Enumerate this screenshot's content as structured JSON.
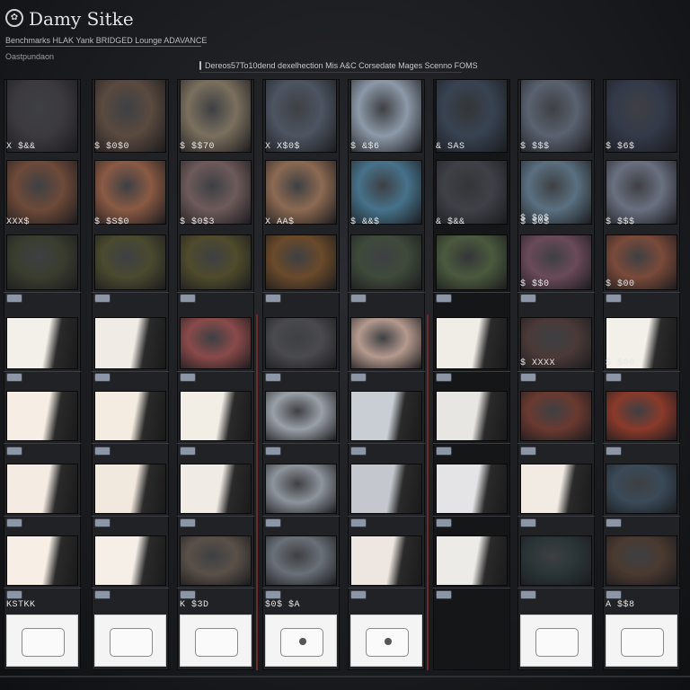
{
  "header": {
    "logo_mark": "✿",
    "brand": "Damy Sitke",
    "subline1": "Benchmarks HLAK Yank BRIDGED Lounge ADAVANCE",
    "subline2": "Oastpundaon",
    "search_text": "Dereos57To10dend dexelhection Mis A&C Corsedate Mages Scenno FOMS"
  },
  "columns": [
    {
      "prices": [
        "X $&&",
        "XXX$",
        "",
        "",
        "",
        "",
        "",
        "KSTKK"
      ],
      "tiles": [
        "#3c3a3f",
        "#6e4a39",
        "#3a3d2e",
        "#f3efe9",
        "#f6eee4",
        "#f4ebe3",
        "#f7efe6"
      ],
      "product": true
    },
    {
      "prices": [
        "$ $0$0",
        "$ $S$0",
        "",
        "",
        "",
        "",
        "",
        ""
      ],
      "tiles": [
        "#5a4a3f",
        "#8a5a44",
        "#4a4a30",
        "#f0ebe5",
        "#f4ece0",
        "#f1e8de",
        "#f5efe8"
      ],
      "product": true
    },
    {
      "prices": [
        "$ $$70",
        "$ $0$3",
        "",
        "",
        "",
        "",
        "",
        "K $3D"
      ],
      "tiles": [
        "#7b705e",
        "#6e5a5a",
        "#4f4b2c",
        "#8a4a4a",
        "#f2ede5",
        "#f0ebe4",
        "#5a5048"
      ],
      "product": true
    },
    {
      "prices": [
        "X X$0$",
        "X AA$",
        "",
        "",
        "",
        "",
        "",
        "$0$ $A"
      ],
      "tiles": [
        "#4d5562",
        "#8c6a52",
        "#6a4a2a",
        "#4a4a4e",
        "#9aa0a8",
        "#8e949c",
        "#6a7078"
      ],
      "product": true
    },
    {
      "prices": [
        "$ &$6",
        "$ &&$",
        "",
        "",
        "",
        "",
        "",
        ""
      ],
      "tiles": [
        "#8c99a8",
        "#46728a",
        "#3f4a3a",
        "#b59a8e",
        "#c9ced4",
        "#c4c8ce",
        "#eee6e0"
      ],
      "product": true
    },
    {
      "prices": [
        "& SAS",
        "& $&&",
        "",
        "",
        "",
        "",
        "",
        ""
      ],
      "tiles": [
        "#384352",
        "#3f4148",
        "#4b5a3e",
        "#f0ece6",
        "#e8e6e2",
        "#e4e4e6",
        "#ecebe8"
      ],
      "product": false
    },
    {
      "prices": [
        "$ $$$",
        "$ $0$",
        "$ $0$",
        "$ $$0",
        "$ XXXX",
        "",
        "",
        ""
      ],
      "tiles": [
        "#5a6270",
        "#5a7080",
        "#6a4a58",
        "#4a3a38",
        "#6a3a30",
        "#f1ebe4",
        "#2a3538"
      ],
      "product": true
    },
    {
      "prices": [
        "$ $6$",
        "$ $$$",
        "",
        "$ $00",
        "$ $00",
        "",
        "",
        "A $$8"
      ],
      "tiles": [
        "#343a4a",
        "#6a7080",
        "#7a4a3a",
        "#f3efe9",
        "#8a3a2a",
        "#3a4a58",
        "#4a3a30"
      ],
      "product": true
    }
  ],
  "accent": "#6a2b2b"
}
